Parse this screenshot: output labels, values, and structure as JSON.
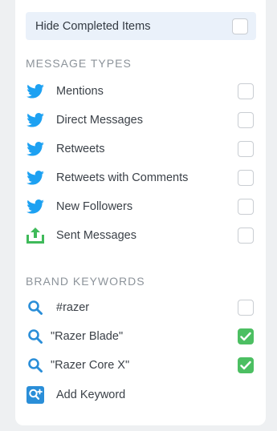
{
  "hide_completed": {
    "label": "Hide Completed Items",
    "checked": false
  },
  "message_types": {
    "title": "MESSAGE TYPES",
    "items": [
      {
        "label": "Mentions",
        "icon": "twitter-icon",
        "checked": false
      },
      {
        "label": "Direct Messages",
        "icon": "twitter-icon",
        "checked": false
      },
      {
        "label": "Retweets",
        "icon": "twitter-icon",
        "checked": false
      },
      {
        "label": "Retweets with Comments",
        "icon": "twitter-icon",
        "checked": false
      },
      {
        "label": "New Followers",
        "icon": "twitter-icon",
        "checked": false
      },
      {
        "label": "Sent Messages",
        "icon": "upload-icon",
        "checked": false
      }
    ]
  },
  "brand_keywords": {
    "title": "BRAND KEYWORDS",
    "items": [
      {
        "label": "#razer",
        "icon": "search-icon",
        "checked": false
      },
      {
        "label": "\"Razer Blade\"",
        "icon": "search-icon",
        "checked": true
      },
      {
        "label": "\"Razer Core X\"",
        "icon": "search-icon",
        "checked": true
      }
    ],
    "add_label": "Add Keyword"
  },
  "colors": {
    "twitter": "#1da1f2",
    "search": "#2a8ed8",
    "upload": "#3fba5a",
    "checked": "#4cbf62"
  }
}
